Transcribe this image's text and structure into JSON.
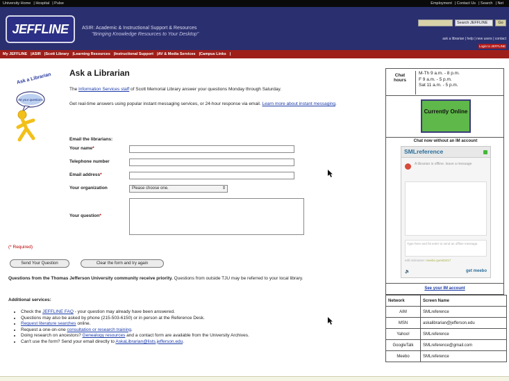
{
  "topbar": {
    "left": [
      "University Home",
      "Hospital",
      "Pulse"
    ],
    "right": [
      "Employment",
      "Contact Us",
      "Search",
      "Net"
    ]
  },
  "header": {
    "logo": "JEFFLINE",
    "tagline": "ASIR: Academic & Instructional Support & Resources",
    "subtagline": "\"Bringing Knowledge Resources to Your Desktop\"",
    "search_select": "Search JEFFLINE",
    "search_go": "Go",
    "util_links": "ask a librarian | help | new users | contact",
    "login": "Login to JEFFLINE"
  },
  "nav": [
    "My JEFFLINE",
    "ASIR",
    "Scott Library",
    "Learning Resources",
    "Instructional Support",
    "AV & Media Services",
    "Campus Links"
  ],
  "badge": {
    "line1": "Ask a Librarian",
    "bubble": "IM your questions"
  },
  "main": {
    "title": "Ask a Librarian",
    "intro1_pre": "The",
    "intro1_link": "Information Services staff",
    "intro1_post": "of Scott Memorial Library answer your questions Monday through Saturday.",
    "intro2_pre": "Get real-time answers using popular instant messaging services, or 24-hour response via email.",
    "intro2_link": "Learn more about instant messaging",
    "form_heading": "Email the librarians:",
    "fields": {
      "name": "Your name",
      "phone": "Telephone number",
      "email": "Email address",
      "org": "Your organization",
      "question": "Your question"
    },
    "org_select": "Please choose one.",
    "required_note": "(* Required)",
    "send_btn": "Send Your Question",
    "clear_btn": "Clear the form and try again",
    "priority": "Questions from the Thomas Jefferson University community receive priority.",
    "priority_rest": "Questions from outside TJU may be referred to your local library.",
    "additional": "Additional services:",
    "services": [
      [
        "Check the",
        "JEFFLINE FAQ",
        "- your question may already have been answered."
      ],
      [
        "Questions may also be asked by phone (215-503-6150) or in person at the Reference Desk.",
        "",
        ""
      ],
      [
        "",
        "Request literature searches",
        "online."
      ],
      [
        "Request a one-on-one",
        "consultation or research training",
        "."
      ],
      [
        "Doing research on ancestors?",
        "Genealogy resources",
        "and a contact form are available from the University Archives."
      ],
      [
        "Can't use the form? Send your email directly to",
        "AskaLibrarian@lists.jefferson.edu",
        "."
      ]
    ]
  },
  "sidebar": {
    "hours_label": "Chat hours",
    "hours": [
      "M-Th 9 a.m. - 8 p.m.",
      "F 9 a.m. - 5 p.m.",
      "Sat 11 a.m. - 5 p.m."
    ],
    "online_label": "Currently Online",
    "widget_caption": "Chat now without an IM account",
    "widget_title": "SMLreference",
    "widget_status": "A librarian is offline. leave a message",
    "widget_input_hint": "Type here and hit enter to send an offline message.",
    "widget_nick": "edit nickname",
    "widget_nick_val": "meebo guest3417",
    "widget_brand": "get meebo",
    "see_im": "See your IM account",
    "table_headers": [
      "Network",
      "Screen Name"
    ],
    "accounts": [
      [
        "AIM",
        "SMLreference"
      ],
      [
        "MSN",
        "askalibrarian@jefferson.edu"
      ],
      [
        "Yahoo!",
        "SMLreference"
      ],
      [
        "GoogleTalk",
        "SMLreference@gmail.com"
      ],
      [
        "Meebo",
        "SMLreference"
      ]
    ]
  },
  "colors": {
    "header_bg": "#2a2f6f",
    "nav_bg": "#9e1f1a",
    "online_green": "#5fb84a",
    "link": "#1a3aa8"
  }
}
